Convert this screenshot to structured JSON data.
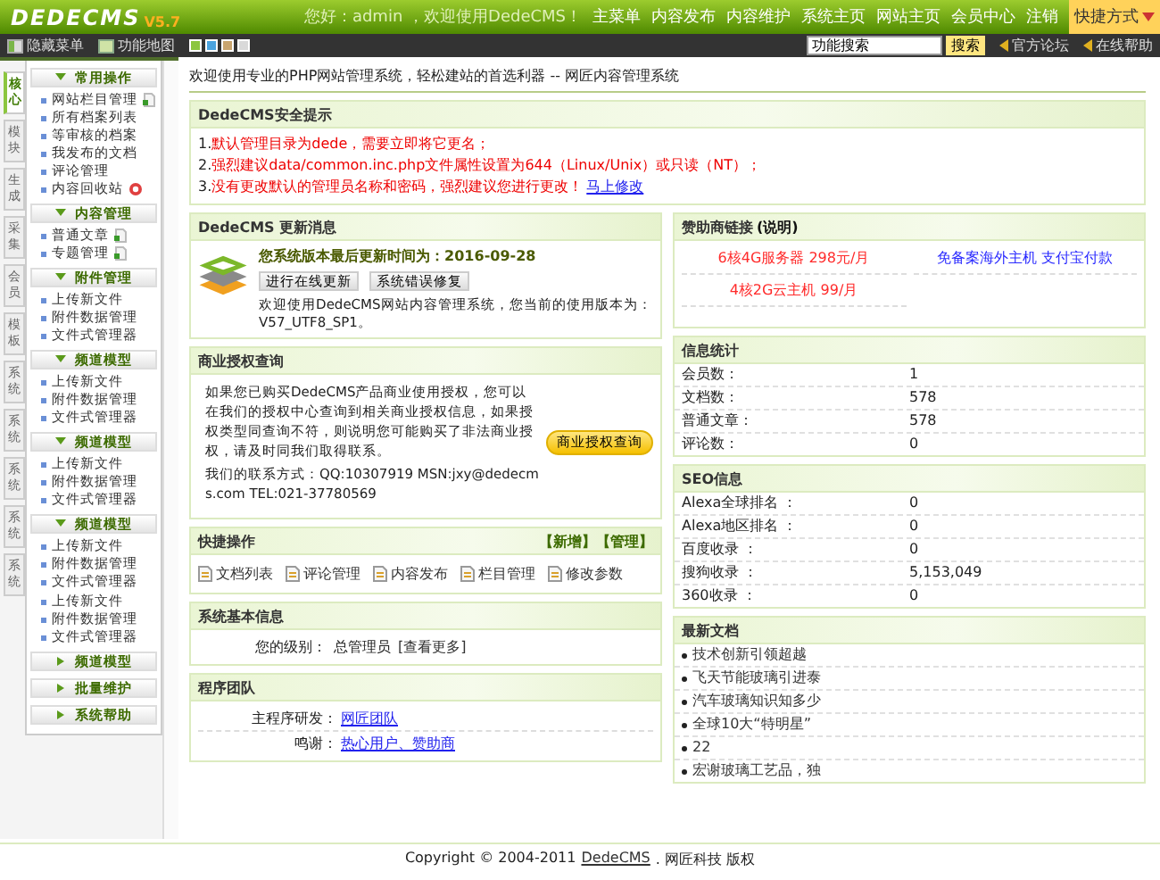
{
  "header": {
    "logo": "DEDECMS",
    "version": "V5.7",
    "greeting": "您好：admin ，欢迎使用DedeCMS！",
    "nav": [
      "主菜单",
      "内容发布",
      "内容维护",
      "系统主页",
      "网站主页",
      "会员中心",
      "注销"
    ],
    "shortcut": "快捷方式"
  },
  "toolbar": {
    "hide_menu": "隐藏菜单",
    "site_map": "功能地图",
    "themes": [
      {
        "color": "#8cc63f"
      },
      {
        "color": "#4aa3df"
      },
      {
        "color": "#c8a46e"
      },
      {
        "color": "#d9d9d9"
      }
    ],
    "search": {
      "value": "功能搜索"
    },
    "search_button": "搜索",
    "links": [
      "官方论坛",
      "在线帮助"
    ]
  },
  "sidebar": {
    "tabs": [
      {
        "label": "核心",
        "selected": true
      },
      {
        "label": "模块",
        "selected": false
      },
      {
        "label": "生成",
        "selected": false
      },
      {
        "label": "采集",
        "selected": false
      },
      {
        "label": "会员",
        "selected": false
      },
      {
        "label": "模板",
        "selected": false
      },
      {
        "label": "系统",
        "selected": false
      },
      {
        "label": "系统",
        "selected": false
      },
      {
        "label": "系统",
        "selected": false
      },
      {
        "label": "系统",
        "selected": false
      },
      {
        "label": "系统",
        "selected": false
      }
    ],
    "groups": [
      {
        "title": "常用操作",
        "expanded": true,
        "items": [
          {
            "label": "网站栏目管理",
            "kind": "add"
          },
          {
            "label": "所有档案列表",
            "kind": "plain"
          },
          {
            "label": "等审核的档案",
            "kind": "plain"
          },
          {
            "label": "我发布的文档",
            "kind": "plain"
          },
          {
            "label": "评论管理",
            "kind": "plain"
          },
          {
            "label": "内容回收站",
            "kind": "delete"
          }
        ]
      },
      {
        "title": "内容管理",
        "expanded": true,
        "items": [
          {
            "label": "普通文章",
            "kind": "add"
          },
          {
            "label": "专题管理",
            "kind": "add"
          }
        ]
      },
      {
        "title": "附件管理",
        "expanded": true,
        "items": [
          {
            "label": "上传新文件"
          },
          {
            "label": "附件数据管理"
          },
          {
            "label": "文件式管理器"
          }
        ]
      },
      {
        "title": "频道模型",
        "expanded": true,
        "items": [
          {
            "label": "上传新文件"
          },
          {
            "label": "附件数据管理"
          },
          {
            "label": "文件式管理器"
          }
        ]
      },
      {
        "title": "频道模型",
        "expanded": true,
        "items": [
          {
            "label": "上传新文件"
          },
          {
            "label": "附件数据管理"
          },
          {
            "label": "文件式管理器"
          }
        ]
      },
      {
        "title": "频道模型",
        "expanded": true,
        "items": [
          {
            "label": "上传新文件"
          },
          {
            "label": "附件数据管理"
          },
          {
            "label": "文件式管理器"
          }
        ]
      },
      {
        "expanded": true,
        "items": [
          {
            "label": "上传新文件"
          },
          {
            "label": "附件数据管理"
          },
          {
            "label": "文件式管理器"
          }
        ]
      },
      {
        "title": "频道模型",
        "expanded": false
      },
      {
        "title": "批量维护",
        "expanded": false
      },
      {
        "title": "系统帮助",
        "expanded": false
      }
    ]
  },
  "breadcrumb": "欢迎使用专业的PHP网站管理系统，轻松建站的首选利器 -- 网匠内容管理系统",
  "security": {
    "title": "DedeCMS安全提示",
    "lines": [
      {
        "number": "1.",
        "text": "默认管理目录为dede，需要立即将它更名；"
      },
      {
        "number": "2.",
        "text": "强烈建议data/common.inc.php文件属性设置为644（Linux/Unix）或只读（NT）；"
      },
      {
        "number": "3.",
        "text": "没有更改默认的管理员名称和密码，强烈建议您进行更改！",
        "link": "马上修改"
      }
    ]
  },
  "update": {
    "title": "DedeCMS 更新消息",
    "last_update": "您系统版本最后更新时间为：2016-09-28",
    "buttons": [
      "进行在线更新",
      "系统错误修复"
    ],
    "version_text": "欢迎使用DedeCMS网站内容管理系统，您当前的使用版本为：V57_UTF8_SP1。"
  },
  "sponsors": {
    "title": "赞助商链接",
    "title_link": "(说明)",
    "links": [
      {
        "text": "6核4G服务器 298元/月",
        "color": "#ff2a2a"
      },
      {
        "text": "免备案海外主机 支付宝付款",
        "color": "#2a2aff"
      },
      {
        "text": "4核2G云主机 99/月",
        "color": "#ff2a2a"
      }
    ]
  },
  "license": {
    "title": "商业授权查询",
    "text": "如果您已购买DedeCMS产品商业使用授权，您可以在我们的授权中心查询到相关商业授权信息，如果授权类型同查询不符，则说明您可能购买了非法商业授权，请及时同我们取得联系。",
    "contact": "我们的联系方式：QQ:10307919 MSN:jxy@dedecms.com TEL:021-37780569",
    "button": "商业授权查询"
  },
  "stats": {
    "title": "信息统计",
    "rows": [
      {
        "label": "会员数：",
        "value": "1"
      },
      {
        "label": "文档数：",
        "value": "578"
      },
      {
        "label": "普通文章：",
        "value": "578"
      },
      {
        "label": "评论数：",
        "value": "0"
      }
    ]
  },
  "quick": {
    "title": "快捷操作",
    "actions": [
      "【新增】",
      "【管理】"
    ],
    "items": [
      "文档列表",
      "评论管理",
      "内容发布",
      "栏目管理",
      "修改参数"
    ]
  },
  "seo": {
    "title": "SEO信息",
    "rows": [
      {
        "label": "Alexa全球排名 ：",
        "value": "0"
      },
      {
        "label": "Alexa地区排名 ：",
        "value": "0"
      },
      {
        "label": "百度收录 ：",
        "value": "0"
      },
      {
        "label": "搜狗收录 ：",
        "value": "5,153,049"
      },
      {
        "label": "360收录 ：",
        "value": "0"
      }
    ]
  },
  "sysinfo": {
    "title": "系统基本信息",
    "label": "您的级别：",
    "value": "总管理员",
    "link": "[查看更多]"
  },
  "team": {
    "title": "程序团队",
    "rows": [
      {
        "label": "主程序研发：",
        "value": "网匠团队"
      },
      {
        "label": "鸣谢：",
        "value": "热心用户、赞助商"
      }
    ]
  },
  "latest": {
    "title": "最新文档",
    "items": [
      "技术创新引领超越",
      "飞天节能玻璃引进泰",
      "汽车玻璃知识知多少",
      "全球10大“特明星”",
      "22",
      "宏谢玻璃工艺品，独"
    ]
  },
  "footer": {
    "text": "Copyright © 2004-2011",
    "brand": "DedeCMS",
    "rest": ". 网匠科技 版权"
  }
}
